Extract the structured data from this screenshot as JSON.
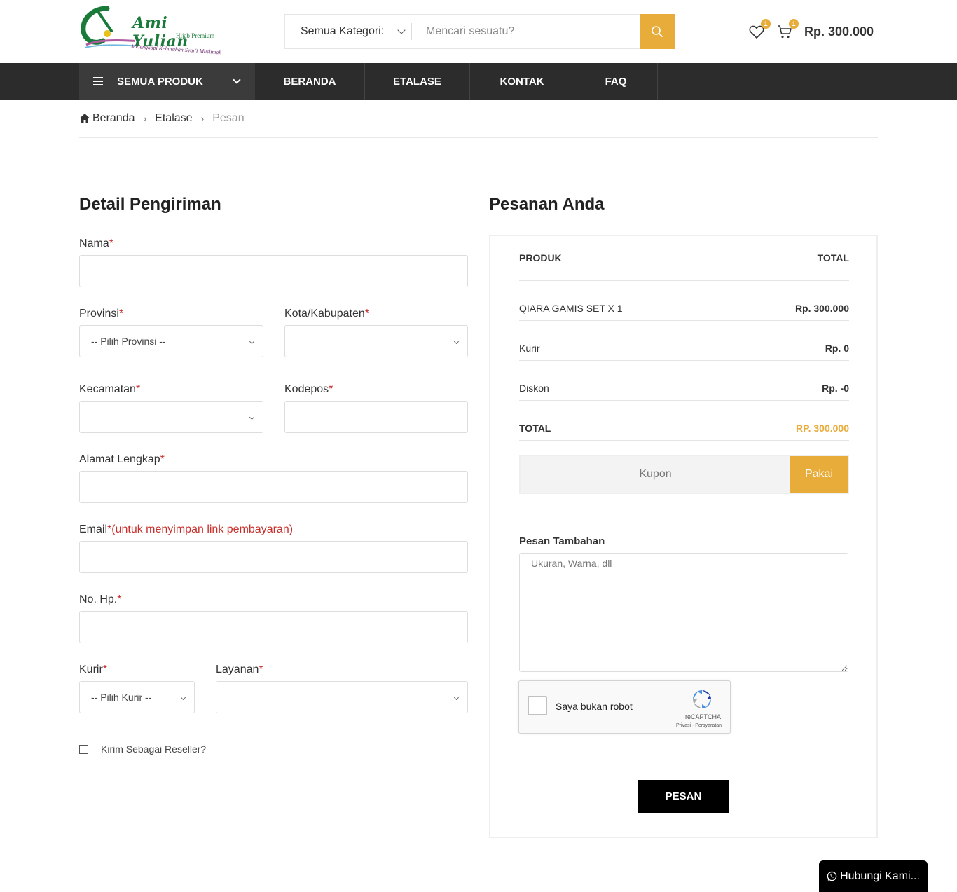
{
  "header": {
    "logo": {
      "brand": "Ami Yulian",
      "tagline": "Hijab Premium",
      "slogan": "Melengkapi Kebutuhan Syar'i Muslimah"
    },
    "search": {
      "category_label": "Semua Kategori:",
      "placeholder": "Mencari sesuatu?"
    },
    "wishlist_count": "1",
    "cart_count": "1",
    "cart_total": "Rp. 300.000",
    "colors": {
      "accent": "#e8ac3b",
      "nav_bg": "#2c2c2c"
    }
  },
  "nav": {
    "all_products": "SEMUA PRODUK",
    "items": [
      "BERANDA",
      "ETALASE",
      "KONTAK",
      "FAQ"
    ]
  },
  "breadcrumb": {
    "home": "Beranda",
    "level1": "Etalase",
    "current": "Pesan"
  },
  "shipping": {
    "title": "Detail Pengiriman",
    "required_mark": "*",
    "nama_label": "Nama",
    "provinsi_label": "Provinsi",
    "provinsi_value": "-- Pilih Provinsi --",
    "kota_label": "Kota/Kabupaten",
    "kecamatan_label": "Kecamatan",
    "kodepos_label": "Kodepos",
    "alamat_label": "Alamat Lengkap",
    "email_label": "Email",
    "email_note": "(untuk menyimpan link pembayaran)",
    "hp_label": "No. Hp.",
    "kurir_label": "Kurir",
    "kurir_value": "-- Pilih Kurir --",
    "layanan_label": "Layanan",
    "reseller_label": "Kirim Sebagai Reseller?"
  },
  "order": {
    "title": "Pesanan Anda",
    "col_product": "PRODUK",
    "col_total": "TOTAL",
    "product_name": "QIARA GAMIS SET X 1",
    "product_price": "Rp. 300.000",
    "kurir_label": "Kurir",
    "kurir_value": "Rp. 0",
    "diskon_label": "Diskon",
    "diskon_value": "Rp. -0",
    "total_label": "TOTAL",
    "total_value": "RP. 300.000",
    "coupon_placeholder": "Kupon",
    "coupon_button": "Pakai",
    "note_label": "Pesan Tambahan",
    "note_placeholder": "Ukuran, Warna, dll",
    "captcha_text": "Saya bukan robot",
    "captcha_brand": "reCAPTCHA",
    "captcha_links": "Privasi - Persyaratan",
    "submit": "PESAN"
  },
  "contact_button": "Hubungi Kami..."
}
